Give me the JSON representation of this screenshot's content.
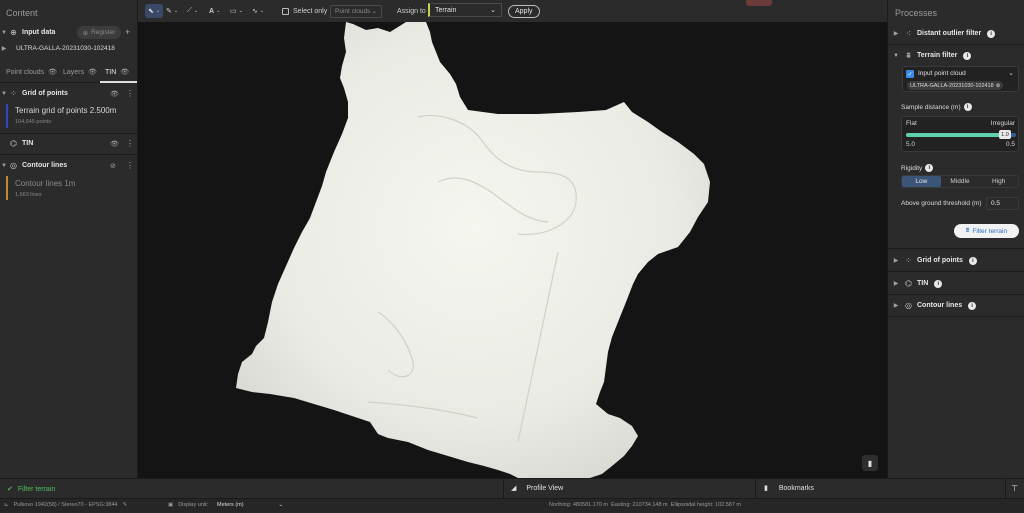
{
  "left_panel": {
    "title": "Content",
    "input_data": {
      "label": "Input data",
      "register": "Register",
      "dataset": "ULTRA-GALLA-20231030-102418"
    },
    "tabs": [
      "Point clouds",
      "Layers",
      "TIN"
    ],
    "grid_of_points": {
      "label": "Grid of points",
      "layer_name": "Terrain grid of points 2.500m",
      "layer_count": "104,645 points",
      "color": "#3346c4"
    },
    "tin": {
      "label": "TIN"
    },
    "contour_lines": {
      "label": "Contour lines",
      "layer_name": "Contour lines 1m",
      "layer_count": "1,663 lines",
      "color": "#c58a2d"
    }
  },
  "toolbar": {
    "select_only": "Select only",
    "point_clouds_dropdown": "Point clouds",
    "assign_to": "Assign to",
    "terrain_dropdown": "Terrain",
    "apply": "Apply"
  },
  "right_panel": {
    "title": "Processes",
    "distant_outlier_filter": "Distant outlier filter",
    "terrain_filter": "Terrain filter",
    "input_point_cloud": "Input point cloud",
    "input_chip": "ULTRA-GALLA-20231030-102418",
    "sample_distance": "Sample distance (m)",
    "slider": {
      "left_label": "Flat",
      "right_label": "Irregular",
      "min": "5.0",
      "max": "0.5",
      "value": "1.0",
      "fraction": 0.9
    },
    "rigidity": "Rigidity",
    "rigidity_options": [
      "Low",
      "Middle",
      "High"
    ],
    "rigidity_selected": "Low",
    "above_ground": "Above ground threshold (m)",
    "above_ground_value": "0.5",
    "filter_button": "Filter terrain",
    "grid_of_points": "Grid of points",
    "tin": "TIN",
    "contour_lines": "Contour lines"
  },
  "status": {
    "task": "Filter terrain",
    "profile_view": "Profile View",
    "bookmarks": "Bookmarks",
    "crs": "Pulkovo 1942(58) / Stereo70 - EPSG:3844",
    "display_unit_label": "Display unit:",
    "display_unit_value": "Meters (m)",
    "coordinates": "Northing: 480581.170 m  Easting: 210734.148 m  Ellipsoidal height: 102.587 m"
  },
  "colors": {
    "accent": "#3d8be0",
    "selected": "#3a5578",
    "success": "#49b85a",
    "slider_fill": "#5fd0b0"
  }
}
